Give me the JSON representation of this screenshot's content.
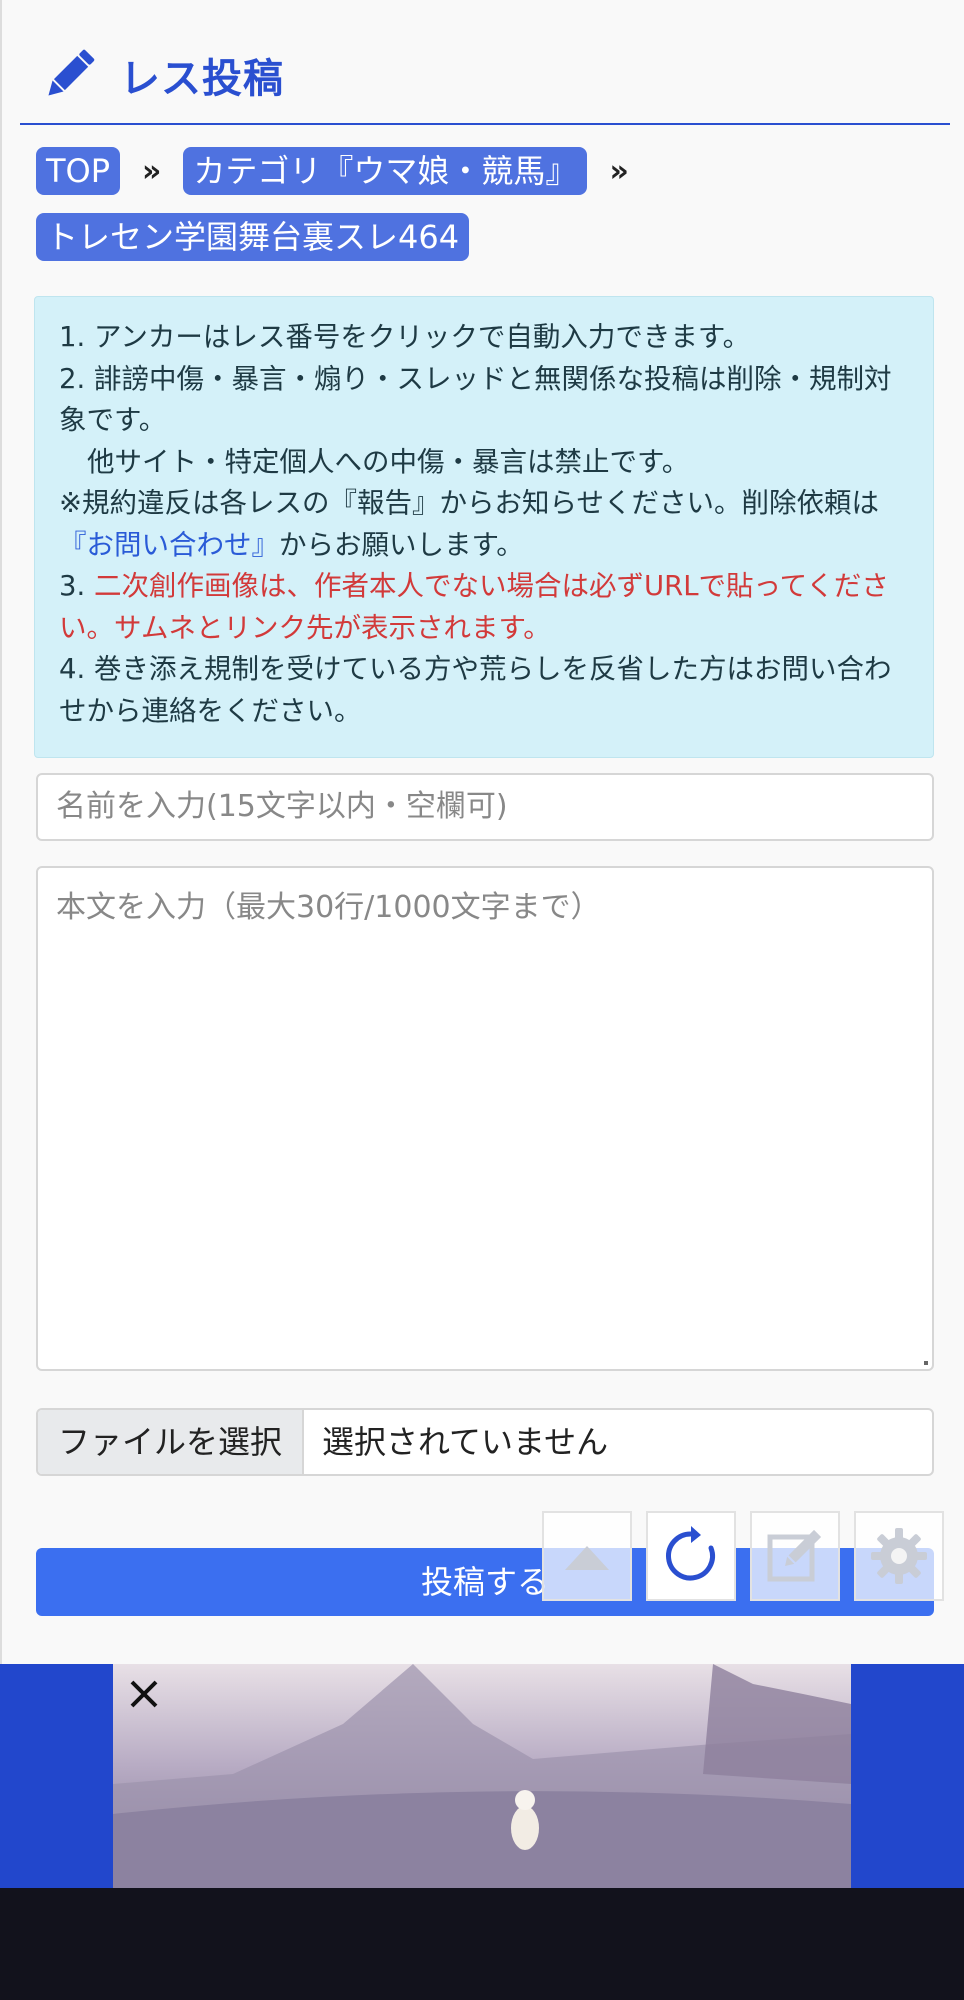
{
  "header": {
    "title": "レス投稿",
    "icon": "pencil-icon"
  },
  "breadcrumb": {
    "items": [
      "TOP",
      "カテゴリ『ウマ娘・競馬』",
      "トレセン学園舞台裏スレ464"
    ],
    "separator": "»"
  },
  "notice": {
    "line1": "1. アンカーはレス番号をクリックで自動入力できます。",
    "line2": "2. 誹謗中傷・暴言・煽り・スレッドと無関係な投稿は削除・規制対象です。",
    "line3": "他サイト・特定個人への中傷・暴言は禁止です。",
    "line4_a": "※規約違反は各レスの『報告』からお知らせください。削除依頼は",
    "line4_link": "『お問い合わせ』",
    "line4_b": "からお願いします。",
    "line5_prefix": "3. ",
    "line5_red": "二次創作画像は、作者本人でない場合は必ずURLで貼ってください。サムネとリンク先が表示されます。",
    "line6": "4. 巻き添え規制を受けている方や荒らしを反省した方はお問い合わせから連絡をください。"
  },
  "form": {
    "name_placeholder": "名前を入力(15文字以内・空欄可)",
    "body_placeholder": "本文を入力（最大30行/1000文字まで）",
    "file_button": "ファイルを選択",
    "file_status": "選択されていません",
    "submit_label": "投稿する"
  },
  "floating_buttons": [
    "scroll-top-icon",
    "reload-icon",
    "edit-icon",
    "settings-icon"
  ],
  "colors": {
    "accent": "#2a4fd0",
    "chip": "#4f72e0",
    "submit": "#3b6ff0",
    "notice_bg": "#d4f1f9",
    "warning": "#d23a3a",
    "ad_bg": "#2247cc"
  }
}
